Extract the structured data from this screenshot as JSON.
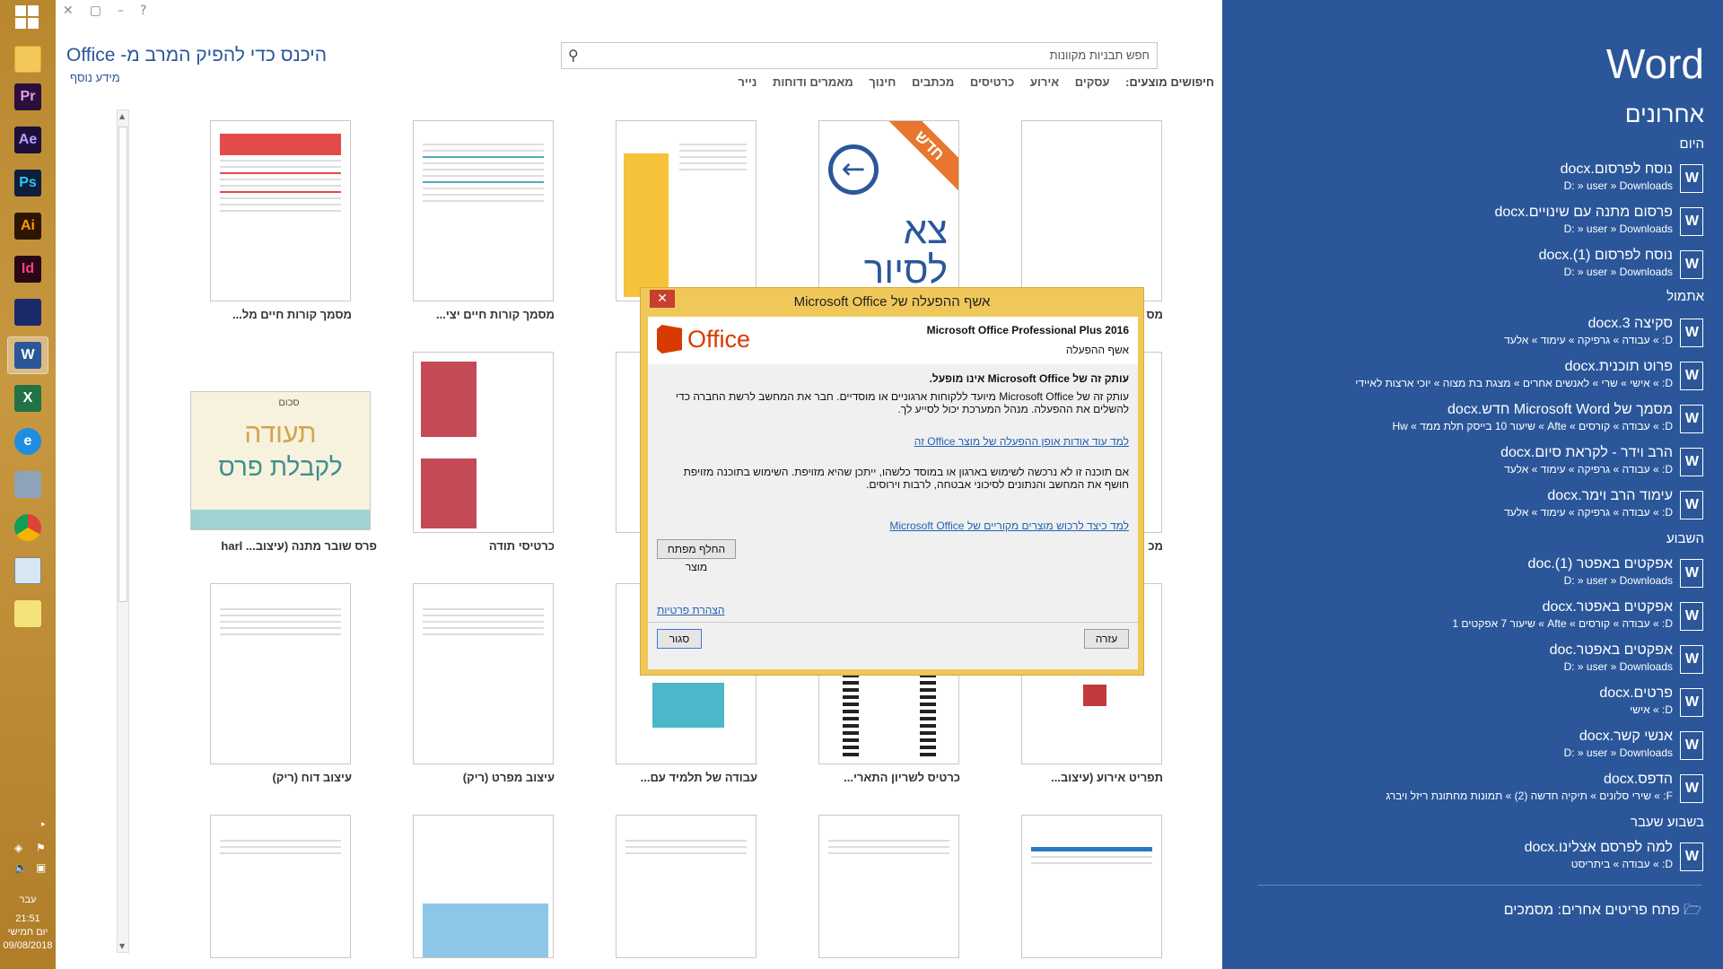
{
  "taskbar": {
    "apps": [
      {
        "name": "Pr",
        "bg": "#2a0f3c",
        "fg": "#e59ee5"
      },
      {
        "name": "Ae",
        "bg": "#1e0f3a",
        "fg": "#b7a1ff"
      },
      {
        "name": "Ps",
        "bg": "#0d1f3c",
        "fg": "#31c5f0"
      },
      {
        "name": "Ai",
        "bg": "#2b1604",
        "fg": "#ff9a00"
      },
      {
        "name": "Id",
        "bg": "#2a0715",
        "fg": "#ff3d8b"
      }
    ],
    "clock": {
      "day": "עבר",
      "time": "21:51",
      "weekday": "יום חמישי",
      "date": "09/08/2018"
    }
  },
  "main": {
    "signin": "היכנס כדי להפיק המרב מ- Office",
    "more_info": "מידע נוסף",
    "search_placeholder": "חפש תבניות מקוונות",
    "suggested_label": "חיפושים מוצעים:",
    "suggested": [
      "עסקים",
      "אירוע",
      "כרטיסים",
      "מכתבים",
      "חינוך",
      "מאמרים ודוחות",
      "נייר"
    ],
    "templates": [
      {
        "caption": "מסמך קורות חיים מל..."
      },
      {
        "caption": "מסמך קורות חיים יצי..."
      },
      {
        "caption": ""
      },
      {
        "caption": ""
      },
      {
        "caption": "מס"
      },
      {
        "caption": "פרס שובר מתנה (עיצוב... harl"
      },
      {
        "caption": "כרטיסי תודה"
      },
      {
        "caption": ""
      },
      {
        "caption": ""
      },
      {
        "caption": "מכ"
      },
      {
        "caption": "עיצוב דוח (ריק)"
      },
      {
        "caption": "עיצוב מפרט (ריק)"
      },
      {
        "caption": "עבודה של תלמיד עם..."
      },
      {
        "caption": "כרטיס לשריון התארי..."
      },
      {
        "caption": "תפריט אירוע (עיצוב..."
      }
    ],
    "tour_new": "חדש",
    "tour_text": "צא לסיור",
    "cert_label": "סכום",
    "cert_line1": "תעודה",
    "cert_line2": "לקבלת פרס"
  },
  "right": {
    "app_name": "Word",
    "recent_heading": "אחרונים",
    "groups": [
      {
        "title": "היום",
        "items": [
          {
            "name": "נוסח לפרסום.docx",
            "path": "D: » user » Downloads"
          },
          {
            "name": "פרסום מתנה עם שינויים.docx",
            "path": "D: » user » Downloads"
          },
          {
            "name": "נוסח לפרסום (1).docx",
            "path": "D: » user » Downloads"
          }
        ]
      },
      {
        "title": "אתמול",
        "items": [
          {
            "name": "סקיצה 3.docx",
            "path": "D: » עבודה » גרפיקה » עימוד » אלעד"
          },
          {
            "name": "פרוט תוכנית.docx",
            "path": "D: » אישי » שרי » לאנשים אחרים » מצגת בת מצוה » יוכי ארצות לאיידי"
          },
          {
            "name": "מסמך של Microsoft Word חדש.docx",
            "path": "D: » עבודה » קורסים » Afte » שיעור 10 בייסק תלת ממד » Hw"
          },
          {
            "name": "הרב וידר - לקראת סיום.docx",
            "path": "D: » עבודה » גרפיקה » עימוד » אלעד"
          },
          {
            "name": "עימוד הרב וימר.docx",
            "path": "D: » עבודה » גרפיקה » עימוד » אלעד"
          }
        ]
      },
      {
        "title": "השבוע",
        "items": [
          {
            "name": "אפקטים באפטר (1).doc",
            "path": "D: » user » Downloads"
          },
          {
            "name": "אפקטים באפטר.docx",
            "path": "D: » עבודה » קורסים » Afte » שיעור 7 אפקטים 1"
          },
          {
            "name": "אפקטים באפטר.doc",
            "path": "D: » user » Downloads"
          },
          {
            "name": "פרטים.docx",
            "path": "D: » אישי"
          },
          {
            "name": "אנשי קשר.docx",
            "path": "D: » user » Downloads"
          },
          {
            "name": "הדפס.docx",
            "path": "F: » שירי סלונים » תיקיה חדשה (2) » תמונות מחתונת ריזל ויברג"
          }
        ]
      },
      {
        "title": "בשבוע שעבר",
        "items": [
          {
            "name": "למה לפרסם אצלינו.docx",
            "path": "D: » עבודה » ביתריסט"
          }
        ]
      }
    ],
    "open_other": "פתח פריטים אחרים: מסמכים"
  },
  "dialog": {
    "title": "אשף ההפעלה של Microsoft Office",
    "close": "✕",
    "logo_text": "Office",
    "product": "Microsoft Office Professional Plus 2016",
    "subtitle": "אשף ההפעלה",
    "warning_title": "עותק זה של Microsoft Office אינו מופעל.",
    "warning_body": "עותק זה של Microsoft Office מיועד ללקוחות ארגוניים או מוסדיים. חבר את המחשב לרשת החברה כדי להשלים את ההפעלה. מנהל המערכת יכול לסייע לך.",
    "link1": "למד עוד אודות אופן ההפעלה של מוצר Office זה",
    "piracy_body": "אם תוכנה זו לא נרכשה לשימוש בארגון או במוסד כלשהו, ייתכן שהיא מזויפת. השימוש בתוכנה מזויפת חושף את המחשב והנתונים לסיכוני אבטחה, לרבות וירוסים.",
    "link2": "למד כיצד לרכוש מוצרים מקוריים של Microsoft Office",
    "change_key": "החלף מפתח מוצר",
    "privacy": "הצהרת פרטיות",
    "help": "עזרה",
    "close_btn": "סגור"
  }
}
